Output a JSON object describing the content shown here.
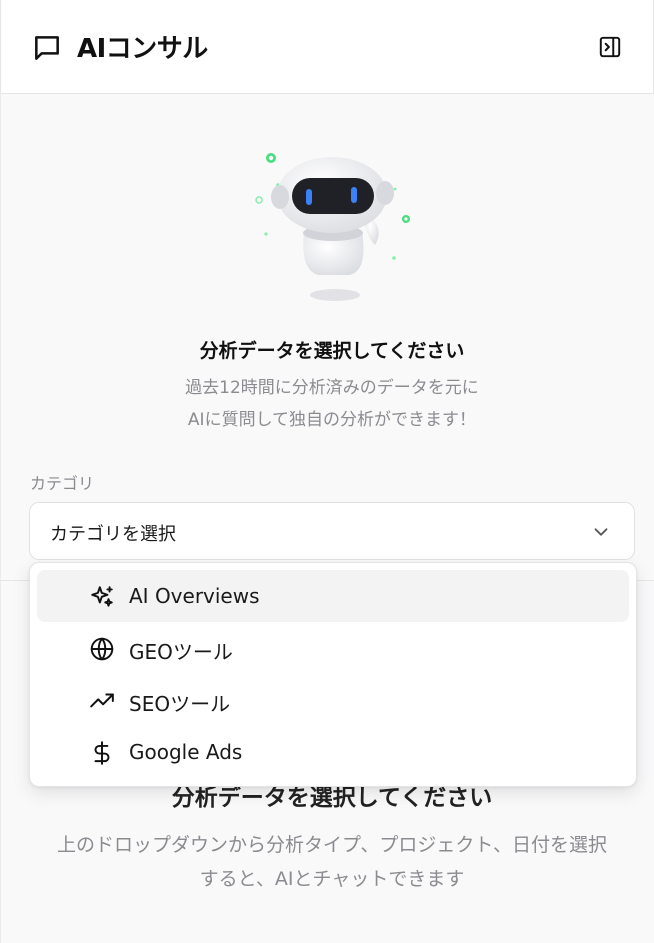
{
  "header": {
    "title": "AIコンサル",
    "chat_icon": "message-square-icon",
    "panel_icon": "panel-collapse-icon"
  },
  "hero": {
    "illustration": "robot-illustration",
    "title": "分析データを選択してください",
    "desc_line1": "過去12時間に分析済みのデータを元に",
    "desc_line2": "AIに質問して独自の分析ができます！"
  },
  "category": {
    "label": "カテゴリ",
    "placeholder": "カテゴリを選択",
    "chevron_icon": "chevron-down-icon",
    "options": [
      {
        "label": "AI Overviews",
        "icon": "sparkles-icon",
        "highlighted": true
      },
      {
        "label": "GEOツール",
        "icon": "globe-icon",
        "highlighted": false
      },
      {
        "label": "SEOツール",
        "icon": "trending-up-icon",
        "highlighted": false
      },
      {
        "label": "Google Ads",
        "icon": "dollar-sign-icon",
        "highlighted": false
      }
    ]
  },
  "empty_state": {
    "title": "分析データを選択してください",
    "desc_line1": "上のドロップダウンから分析タイプ、プロジェクト、日付を選択",
    "desc_line2": "すると、AIとチャットできます"
  },
  "colors": {
    "background": "#f9f9fa",
    "muted_text": "#8b8b90",
    "robot_accent": "#3b82f6",
    "sparkle_green": "#4ade80"
  }
}
